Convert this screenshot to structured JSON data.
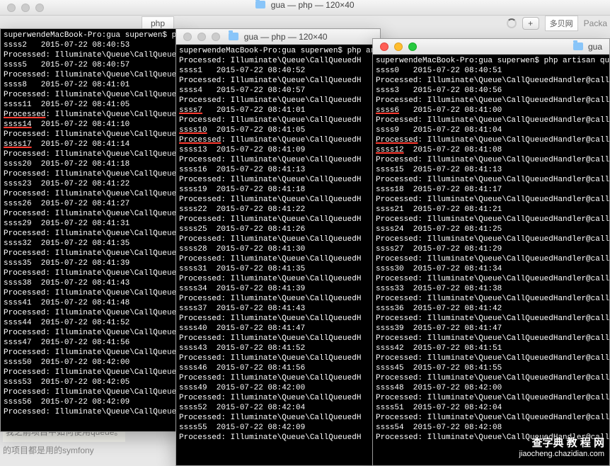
{
  "top_title": "gua — php — 120×40",
  "bg_tab_label": "php",
  "bg_chinese": "多贝网",
  "bg_packa": "Packa",
  "bg_plus": "+",
  "window1": {
    "title": "",
    "prompt": "superwendeMacBook-Pro:gua superwen$ php",
    "lines": [
      "ssss2   2015-07-22 08:40:53",
      "Processed: Illuminate\\Queue\\CallQueuedH",
      "ssss5   2015-07-22 08:40:57",
      "Processed: Illuminate\\Queue\\CallQueuedH",
      "ssss8   2015-07-22 08:41:01",
      "Processed: Illuminate\\Queue\\CallQueuedH",
      "ssss11  2015-07-22 08:41:05",
      "Processed: Illuminate\\Queue\\CallQueuedH",
      "ssss14  2015-07-22 08:41:10",
      "Processed: Illuminate\\Queue\\CallQueuedH",
      "ssss17  2015-07-22 08:41:14",
      "Processed: Illuminate\\Queue\\CallQueuedH",
      "ssss20  2015-07-22 08:41:18",
      "Processed: Illuminate\\Queue\\CallQueuedH",
      "ssss23  2015-07-22 08:41:22",
      "Processed: Illuminate\\Queue\\CallQueuedH",
      "ssss26  2015-07-22 08:41:27",
      "Processed: Illuminate\\Queue\\CallQueuedH",
      "ssss29  2015-07-22 08:41:31",
      "Processed: Illuminate\\Queue\\CallQueuedH",
      "ssss32  2015-07-22 08:41:35",
      "Processed: Illuminate\\Queue\\CallQueuedH",
      "ssss35  2015-07-22 08:41:39",
      "Processed: Illuminate\\Queue\\CallQueuedH",
      "ssss38  2015-07-22 08:41:43",
      "Processed: Illuminate\\Queue\\CallQueuedH",
      "ssss41  2015-07-22 08:41:48",
      "Processed: Illuminate\\Queue\\CallQueuedH",
      "ssss44  2015-07-22 08:41:52",
      "Processed: Illuminate\\Queue\\CallQueuedH",
      "ssss47  2015-07-22 08:41:56",
      "Processed: Illuminate\\Queue\\CallQueuedH",
      "ssss50  2015-07-22 08:42:00",
      "Processed: Illuminate\\Queue\\CallQueuedH",
      "ssss53  2015-07-22 08:42:05",
      "Processed: Illuminate\\Queue\\CallQueuedH",
      "ssss56  2015-07-22 08:42:09",
      "Processed: Illuminate\\Queue\\CallQueuedH"
    ],
    "underlines_at": [
      "ssss14",
      "ssss17"
    ],
    "processed_underline_at": [
      7
    ]
  },
  "window2": {
    "title": "gua — php — 120×40",
    "prompt": "superwendeMacBook-Pro:gua superwen$ php artisan",
    "lines": [
      "Processed: Illuminate\\Queue\\CallQueuedH",
      "ssss1   2015-07-22 08:40:52",
      "Processed: Illuminate\\Queue\\CallQueuedH",
      "ssss4   2015-07-22 08:40:57",
      "Processed: Illuminate\\Queue\\CallQueuedH",
      "ssss7   2015-07-22 08:41:01",
      "Processed: Illuminate\\Queue\\CallQueuedH",
      "ssss10  2015-07-22 08:41:05",
      "Processed: Illuminate\\Queue\\CallQueuedH",
      "ssss13  2015-07-22 08:41:09",
      "Processed: Illuminate\\Queue\\CallQueuedH",
      "ssss16  2015-07-22 08:41:13",
      "Processed: Illuminate\\Queue\\CallQueuedH",
      "ssss19  2015-07-22 08:41:18",
      "Processed: Illuminate\\Queue\\CallQueuedH",
      "ssss22  2015-07-22 08:41:22",
      "Processed: Illuminate\\Queue\\CallQueuedH",
      "ssss25  2015-07-22 08:41:26",
      "Processed: Illuminate\\Queue\\CallQueuedH",
      "ssss28  2015-07-22 08:41:30",
      "Processed: Illuminate\\Queue\\CallQueuedH",
      "ssss31  2015-07-22 08:41:35",
      "Processed: Illuminate\\Queue\\CallQueuedH",
      "ssss34  2015-07-22 08:41:39",
      "Processed: Illuminate\\Queue\\CallQueuedH",
      "ssss37  2015-07-22 08:41:43",
      "Processed: Illuminate\\Queue\\CallQueuedH",
      "ssss40  2015-07-22 08:41:47",
      "Processed: Illuminate\\Queue\\CallQueuedH",
      "ssss43  2015-07-22 08:41:52",
      "Processed: Illuminate\\Queue\\CallQueuedH",
      "ssss46  2015-07-22 08:41:56",
      "Processed: Illuminate\\Queue\\CallQueuedH",
      "ssss49  2015-07-22 08:42:00",
      "Processed: Illuminate\\Queue\\CallQueuedH",
      "ssss52  2015-07-22 08:42:04",
      "Processed: Illuminate\\Queue\\CallQueuedH",
      "ssss55  2015-07-22 08:42:09",
      "Processed: Illuminate\\Queue\\CallQueuedH"
    ],
    "underlines_at": [
      "ssss7",
      "ssss10"
    ],
    "processed_underline_at": [
      8
    ]
  },
  "window3": {
    "title": "gua",
    "prompt": "superwendeMacBook-Pro:gua superwen$ php artisan queue:l",
    "lines": [
      "ssss0   2015-07-22 08:40:51",
      "Processed: Illuminate\\Queue\\CallQueuedHandler@call",
      "ssss3   2015-07-22 08:40:56",
      "Processed: Illuminate\\Queue\\CallQueuedHandler@call",
      "ssss6   2015-07-22 08:41:00",
      "Processed: Illuminate\\Queue\\CallQueuedHandler@call",
      "ssss9   2015-07-22 08:41:04",
      "Processed: Illuminate\\Queue\\CallQueuedHandler@call",
      "ssss12  2015-07-22 08:41:08",
      "Processed: Illuminate\\Queue\\CallQueuedHandler@call",
      "ssss15  2015-07-22 08:41:13",
      "Processed: Illuminate\\Queue\\CallQueuedHandler@call",
      "ssss18  2015-07-22 08:41:17",
      "Processed: Illuminate\\Queue\\CallQueuedHandler@call",
      "ssss21  2015-07-22 08:41:21",
      "Processed: Illuminate\\Queue\\CallQueuedHandler@call",
      "ssss24  2015-07-22 08:41:25",
      "Processed: Illuminate\\Queue\\CallQueuedHandler@call",
      "ssss27  2015-07-22 08:41:29",
      "Processed: Illuminate\\Queue\\CallQueuedHandler@call",
      "ssss30  2015-07-22 08:41:34",
      "Processed: Illuminate\\Queue\\CallQueuedHandler@call",
      "ssss33  2015-07-22 08:41:38",
      "Processed: Illuminate\\Queue\\CallQueuedHandler@call",
      "ssss36  2015-07-22 08:41:42",
      "Processed: Illuminate\\Queue\\CallQueuedHandler@call",
      "ssss39  2015-07-22 08:41:47",
      "Processed: Illuminate\\Queue\\CallQueuedHandler@call",
      "ssss42  2015-07-22 08:41:51",
      "Processed: Illuminate\\Queue\\CallQueuedHandler@call",
      "ssss45  2015-07-22 08:41:55",
      "Processed: Illuminate\\Queue\\CallQueuedHandler@call",
      "ssss48  2015-07-22 08:42:00",
      "Processed: Illuminate\\Queue\\CallQueuedHandler@call",
      "ssss51  2015-07-22 08:42:04",
      "Processed: Illuminate\\Queue\\CallQueuedHandler@call",
      "ssss54  2015-07-22 08:42:08",
      "Processed: Illuminate\\Queue\\CallQueuedHandler@call"
    ],
    "underlines_at": [
      "ssss6",
      "ssss12"
    ],
    "processed_underline_at": [
      7
    ]
  },
  "bottom_line1": "我之前项目中如何使用queue。",
  "bottom_line2": "的项目都是用的symfony",
  "watermark": {
    "line1": "查字典  教 程 网",
    "line2": "jiaocheng.chazidian.com"
  }
}
